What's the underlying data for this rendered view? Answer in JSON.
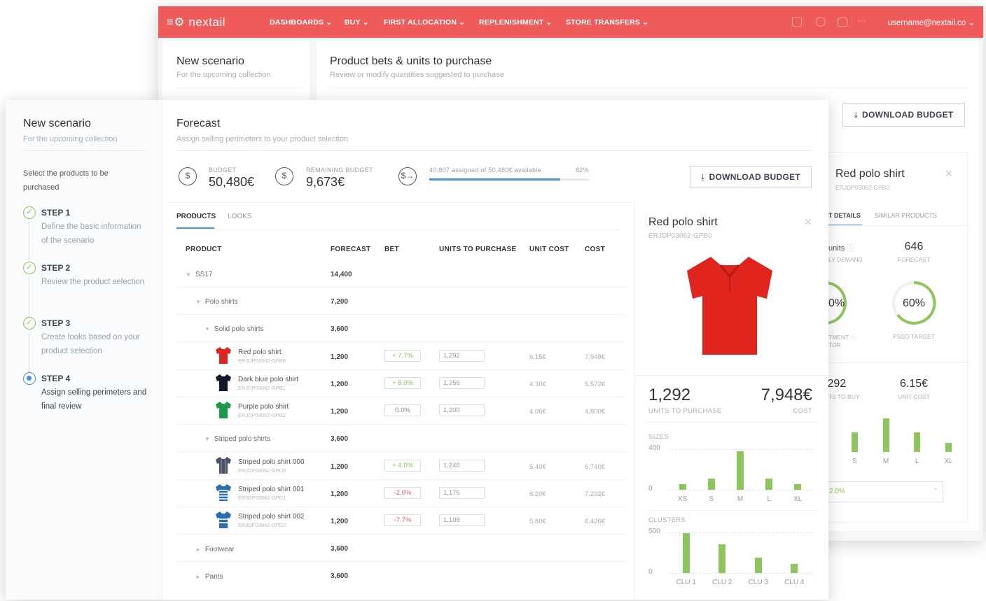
{
  "colors": {
    "brand": "#ef5b5b",
    "green": "#8dc65c",
    "blue": "#4a90e2",
    "red": "#ef5b5b"
  },
  "topbar": {
    "logo": "≡⚙ nextail",
    "nav": [
      "DASHBOARDS ⌄",
      "BUY ⌄",
      "FIRST ALLOCATION ⌄",
      "REPLENISHMENT ⌄",
      "STORE TRANSFERS ⌄"
    ],
    "icons": [
      "chat-icon",
      "globe-icon",
      "bell-icon",
      "more-icon"
    ],
    "user": "username@nextail.co ⌄"
  },
  "back": {
    "scenario_title": "New scenario",
    "scenario_sub": "For the upcoming collection",
    "page_title": "Product bets & units to purchase",
    "page_sub": "Review or modify quantities suggested to purchase",
    "download_label": "DOWNLOAD BUDGET",
    "panel": {
      "title": "Red polo shirt",
      "code": "ERJDP03062-GPB0",
      "tabs": [
        "T DETAILS",
        "SIMILAR PRODUCTS"
      ],
      "units_label": "units",
      "demand_label": "LY DEMAND",
      "forecast_value": "646",
      "forecast_label": "FORECAST",
      "gauge1_value": "0%",
      "gauge1_label1": "TMENT",
      "gauge1_label2": "TOR",
      "gauge2_value": "60%",
      "gauge2_label": "PSSO TARGET",
      "units_to_buy_value": ",292",
      "units_to_buy_label": "TS TO BUY",
      "unit_cost_value": "6.15€",
      "unit_cost_label": "UNIT COST",
      "size_labels": [
        "S",
        "S",
        "M",
        "L",
        "XL"
      ],
      "bet_value": "2.0%"
    }
  },
  "front": {
    "scenario_title": "New scenario",
    "scenario_sub": "For the upcoming collection",
    "intro": "Select the products to be purchased",
    "steps": [
      {
        "title": "STEP 1",
        "desc": "Define the basic information of the scenario",
        "done": true
      },
      {
        "title": "STEP 2",
        "desc": "Review the product selection",
        "done": true
      },
      {
        "title": "STEP 3",
        "desc": "Create looks based on your product selection",
        "done": true
      },
      {
        "title": "STEP 4",
        "desc": "Assign selling perimeters and final review",
        "done": false
      }
    ],
    "page_title": "Forecast",
    "page_sub": "Assign selling perimeters to your product selection",
    "budget": {
      "label": "BUDGET",
      "value": "50,480€"
    },
    "remaining": {
      "label": "REMAINING BUDGET",
      "value": "9,673€"
    },
    "progress": {
      "text": "40,807 assigned of 50,480€ available",
      "percent_label": "82%",
      "percent": 0.82
    },
    "download_label": "DOWNLOAD BUDGET",
    "tabs": [
      "PRODUCTS",
      "LOOKS"
    ],
    "columns": [
      "PRODUCT",
      "FORECAST",
      "BET",
      "UNITS TO PURCHASE",
      "UNIT COST",
      "COST"
    ],
    "groups": [
      {
        "name": "SS17",
        "forecast": "14,400"
      },
      {
        "name": "Polo shirts",
        "forecast": "7,200"
      },
      {
        "name": "Solid polo shirts",
        "forecast": "3,600"
      },
      {
        "name": "Striped polo shirts",
        "forecast": "3,600"
      },
      {
        "name": "Footwear",
        "forecast": "3,600"
      },
      {
        "name": "Pants",
        "forecast": "3,600"
      }
    ],
    "items": [
      {
        "name": "Red polo shirt",
        "code": "ERJDP03062-GPB0",
        "forecast": "1,200",
        "bet": "+ 7.7%",
        "units": "1,292",
        "unit_cost": "6.15€",
        "cost": "7,948€"
      },
      {
        "name": "Dark blue polo shirt",
        "code": "ERJDP03062-GPB1",
        "forecast": "1,200",
        "bet": "+ 8.0%",
        "units": "1,256",
        "unit_cost": "4.30€",
        "cost": "5,572€"
      },
      {
        "name": "Purple polo shirt",
        "code": "ERJDP03062-GPB2",
        "forecast": "1,200",
        "bet": "0.0%",
        "units": "1,200",
        "unit_cost": "4.00€",
        "cost": "4,800€"
      },
      {
        "name": "Striped polo shirt 000",
        "code": "ERJDP03062-GPD0",
        "forecast": "1,200",
        "bet": "+ 4.0%",
        "units": "1,248",
        "unit_cost": "5.40€",
        "cost": "6,740€"
      },
      {
        "name": "Striped polo shirt 001",
        "code": "ERJDP03062-GPD1",
        "forecast": "1,200",
        "bet": "-2.0%",
        "units": "1,176",
        "unit_cost": "6.20€",
        "cost": "7,292€"
      },
      {
        "name": "Striped polo shirt 002",
        "code": "ERJDP03062-GPD2",
        "forecast": "1,200",
        "bet": "-7.7%",
        "units": "1,108",
        "unit_cost": "5.80€",
        "cost": "6,426€"
      }
    ],
    "detail": {
      "title": "Red polo shirt",
      "code": "ERJDP03062-GPB0",
      "units_value": "1,292",
      "units_label": "UNITS TO PURCHASE",
      "cost_value": "7,948€",
      "cost_label": "COST",
      "sizes_label": "SIZES",
      "clusters_label": "CLUSTERS"
    }
  },
  "chart_data": [
    {
      "type": "bar",
      "title": "SIZES",
      "categories": [
        "XS",
        "S",
        "M",
        "L",
        "XL"
      ],
      "values": [
        60,
        130,
        440,
        130,
        60
      ],
      "yticks": [
        "400",
        "0"
      ],
      "ylim": [
        0,
        460
      ]
    },
    {
      "type": "bar",
      "title": "CLUSTERS",
      "categories": [
        "CLU 1",
        "CLU 2",
        "CLU 3",
        "CLU 4"
      ],
      "values": [
        510,
        370,
        200,
        120
      ],
      "yticks": [
        "500",
        "0"
      ],
      "ylim": [
        0,
        520
      ]
    },
    {
      "type": "bar",
      "categories": [
        "S",
        "S",
        "M",
        "L",
        "XL"
      ],
      "values": [
        60,
        130,
        220,
        130,
        60
      ],
      "ylim": [
        0,
        230
      ]
    }
  ]
}
